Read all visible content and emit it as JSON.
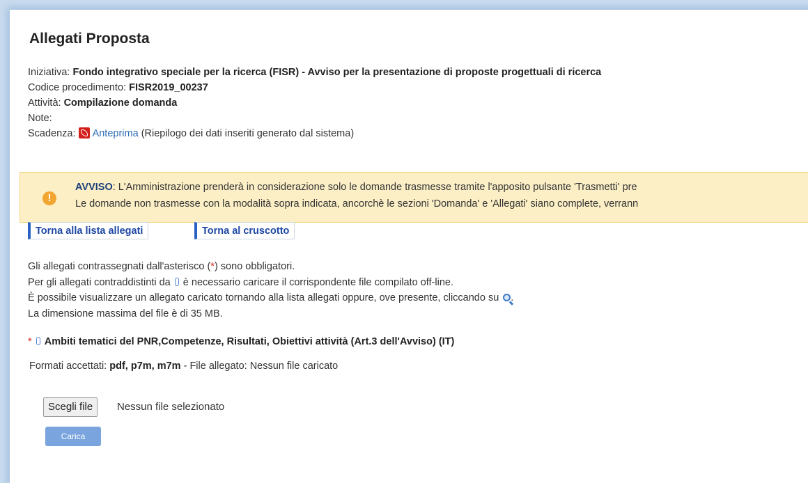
{
  "page": {
    "title": "Allegati Proposta",
    "iniziativa_label": "Iniziativa:",
    "iniziativa_value": "Fondo integrativo speciale per la ricerca (FISR) - Avviso per la presentazione di proposte progettuali di ricerca",
    "codice_label": "Codice procedimento:",
    "codice_value": "FISR2019_00237",
    "attivita_label": "Attività:",
    "attivita_value": "Compilazione domanda",
    "note_label": "Note:",
    "scadenza_label": "Scadenza:",
    "anteprima_link": "Anteprima",
    "anteprima_desc": "(Riepilogo dei dati inseriti generato dal sistema)"
  },
  "alert": {
    "heading": "AVVISO",
    "line1": ": L'Amministrazione prenderà in considerazione solo le domande trasmesse tramite l'apposito pulsante 'Trasmetti' pre",
    "line2": "Le domande non trasmesse con la modalità sopra indicata, ancorchè le sezioni 'Domanda' e 'Allegati' siano complete, verrann"
  },
  "tabs": {
    "back_list": "Torna alla lista allegati",
    "back_dashboard": "Torna al cruscotto"
  },
  "info": {
    "l1_a": "Gli allegati contrassegnati dall'asterisco (",
    "l1_star": "*",
    "l1_b": ") sono obbligatori.",
    "l2_a": "Per gli allegati contraddistinti da",
    "l2_b": "è necessario caricare il corrispondente file compilato off-line.",
    "l3_a": "È possibile visualizzare un allegato caricato tornando alla lista allegati oppure, ove presente, cliccando su",
    "l3_b": ".",
    "l4": "La dimensione massima del file è di 35 MB."
  },
  "attachment": {
    "required_mark": "*",
    "name": "Ambiti tematici del PNR,Competenze, Risultati, Obiettivi attività (Art.3 dell'Avviso) (IT)",
    "formats_label": "Formati accettati:",
    "formats_value": "pdf, p7m, m7m",
    "file_label": "- File allegato: Nessun file caricato"
  },
  "upload": {
    "choose_button": "Scegli file",
    "status": "Nessun file selezionato",
    "upload_button": "Carica"
  },
  "icons": [
    "pdf-icon",
    "warning-icon",
    "paperclip-icon",
    "search-icon"
  ],
  "colors": {
    "accent": "#2a5fc4",
    "alert_bg": "#fcefc6",
    "warning": "#f2a531",
    "required": "#d9261c"
  }
}
